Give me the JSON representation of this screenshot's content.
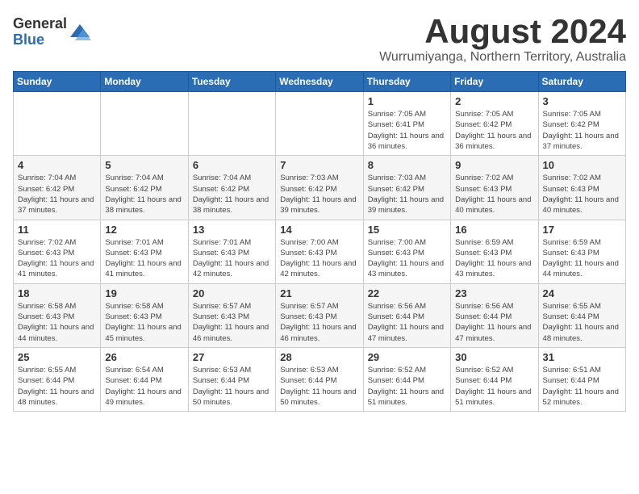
{
  "logo": {
    "general": "General",
    "blue": "Blue"
  },
  "title": "August 2024",
  "subtitle": "Wurrumiyanga, Northern Territory, Australia",
  "days_of_week": [
    "Sunday",
    "Monday",
    "Tuesday",
    "Wednesday",
    "Thursday",
    "Friday",
    "Saturday"
  ],
  "weeks": [
    [
      {
        "day": "",
        "info": ""
      },
      {
        "day": "",
        "info": ""
      },
      {
        "day": "",
        "info": ""
      },
      {
        "day": "",
        "info": ""
      },
      {
        "day": "1",
        "info": "Sunrise: 7:05 AM\nSunset: 6:41 PM\nDaylight: 11 hours and 36 minutes."
      },
      {
        "day": "2",
        "info": "Sunrise: 7:05 AM\nSunset: 6:42 PM\nDaylight: 11 hours and 36 minutes."
      },
      {
        "day": "3",
        "info": "Sunrise: 7:05 AM\nSunset: 6:42 PM\nDaylight: 11 hours and 37 minutes."
      }
    ],
    [
      {
        "day": "4",
        "info": "Sunrise: 7:04 AM\nSunset: 6:42 PM\nDaylight: 11 hours and 37 minutes."
      },
      {
        "day": "5",
        "info": "Sunrise: 7:04 AM\nSunset: 6:42 PM\nDaylight: 11 hours and 38 minutes."
      },
      {
        "day": "6",
        "info": "Sunrise: 7:04 AM\nSunset: 6:42 PM\nDaylight: 11 hours and 38 minutes."
      },
      {
        "day": "7",
        "info": "Sunrise: 7:03 AM\nSunset: 6:42 PM\nDaylight: 11 hours and 39 minutes."
      },
      {
        "day": "8",
        "info": "Sunrise: 7:03 AM\nSunset: 6:42 PM\nDaylight: 11 hours and 39 minutes."
      },
      {
        "day": "9",
        "info": "Sunrise: 7:02 AM\nSunset: 6:43 PM\nDaylight: 11 hours and 40 minutes."
      },
      {
        "day": "10",
        "info": "Sunrise: 7:02 AM\nSunset: 6:43 PM\nDaylight: 11 hours and 40 minutes."
      }
    ],
    [
      {
        "day": "11",
        "info": "Sunrise: 7:02 AM\nSunset: 6:43 PM\nDaylight: 11 hours and 41 minutes."
      },
      {
        "day": "12",
        "info": "Sunrise: 7:01 AM\nSunset: 6:43 PM\nDaylight: 11 hours and 41 minutes."
      },
      {
        "day": "13",
        "info": "Sunrise: 7:01 AM\nSunset: 6:43 PM\nDaylight: 11 hours and 42 minutes."
      },
      {
        "day": "14",
        "info": "Sunrise: 7:00 AM\nSunset: 6:43 PM\nDaylight: 11 hours and 42 minutes."
      },
      {
        "day": "15",
        "info": "Sunrise: 7:00 AM\nSunset: 6:43 PM\nDaylight: 11 hours and 43 minutes."
      },
      {
        "day": "16",
        "info": "Sunrise: 6:59 AM\nSunset: 6:43 PM\nDaylight: 11 hours and 43 minutes."
      },
      {
        "day": "17",
        "info": "Sunrise: 6:59 AM\nSunset: 6:43 PM\nDaylight: 11 hours and 44 minutes."
      }
    ],
    [
      {
        "day": "18",
        "info": "Sunrise: 6:58 AM\nSunset: 6:43 PM\nDaylight: 11 hours and 44 minutes."
      },
      {
        "day": "19",
        "info": "Sunrise: 6:58 AM\nSunset: 6:43 PM\nDaylight: 11 hours and 45 minutes."
      },
      {
        "day": "20",
        "info": "Sunrise: 6:57 AM\nSunset: 6:43 PM\nDaylight: 11 hours and 46 minutes."
      },
      {
        "day": "21",
        "info": "Sunrise: 6:57 AM\nSunset: 6:43 PM\nDaylight: 11 hours and 46 minutes."
      },
      {
        "day": "22",
        "info": "Sunrise: 6:56 AM\nSunset: 6:44 PM\nDaylight: 11 hours and 47 minutes."
      },
      {
        "day": "23",
        "info": "Sunrise: 6:56 AM\nSunset: 6:44 PM\nDaylight: 11 hours and 47 minutes."
      },
      {
        "day": "24",
        "info": "Sunrise: 6:55 AM\nSunset: 6:44 PM\nDaylight: 11 hours and 48 minutes."
      }
    ],
    [
      {
        "day": "25",
        "info": "Sunrise: 6:55 AM\nSunset: 6:44 PM\nDaylight: 11 hours and 48 minutes."
      },
      {
        "day": "26",
        "info": "Sunrise: 6:54 AM\nSunset: 6:44 PM\nDaylight: 11 hours and 49 minutes."
      },
      {
        "day": "27",
        "info": "Sunrise: 6:53 AM\nSunset: 6:44 PM\nDaylight: 11 hours and 50 minutes."
      },
      {
        "day": "28",
        "info": "Sunrise: 6:53 AM\nSunset: 6:44 PM\nDaylight: 11 hours and 50 minutes."
      },
      {
        "day": "29",
        "info": "Sunrise: 6:52 AM\nSunset: 6:44 PM\nDaylight: 11 hours and 51 minutes."
      },
      {
        "day": "30",
        "info": "Sunrise: 6:52 AM\nSunset: 6:44 PM\nDaylight: 11 hours and 51 minutes."
      },
      {
        "day": "31",
        "info": "Sunrise: 6:51 AM\nSunset: 6:44 PM\nDaylight: 11 hours and 52 minutes."
      }
    ]
  ]
}
